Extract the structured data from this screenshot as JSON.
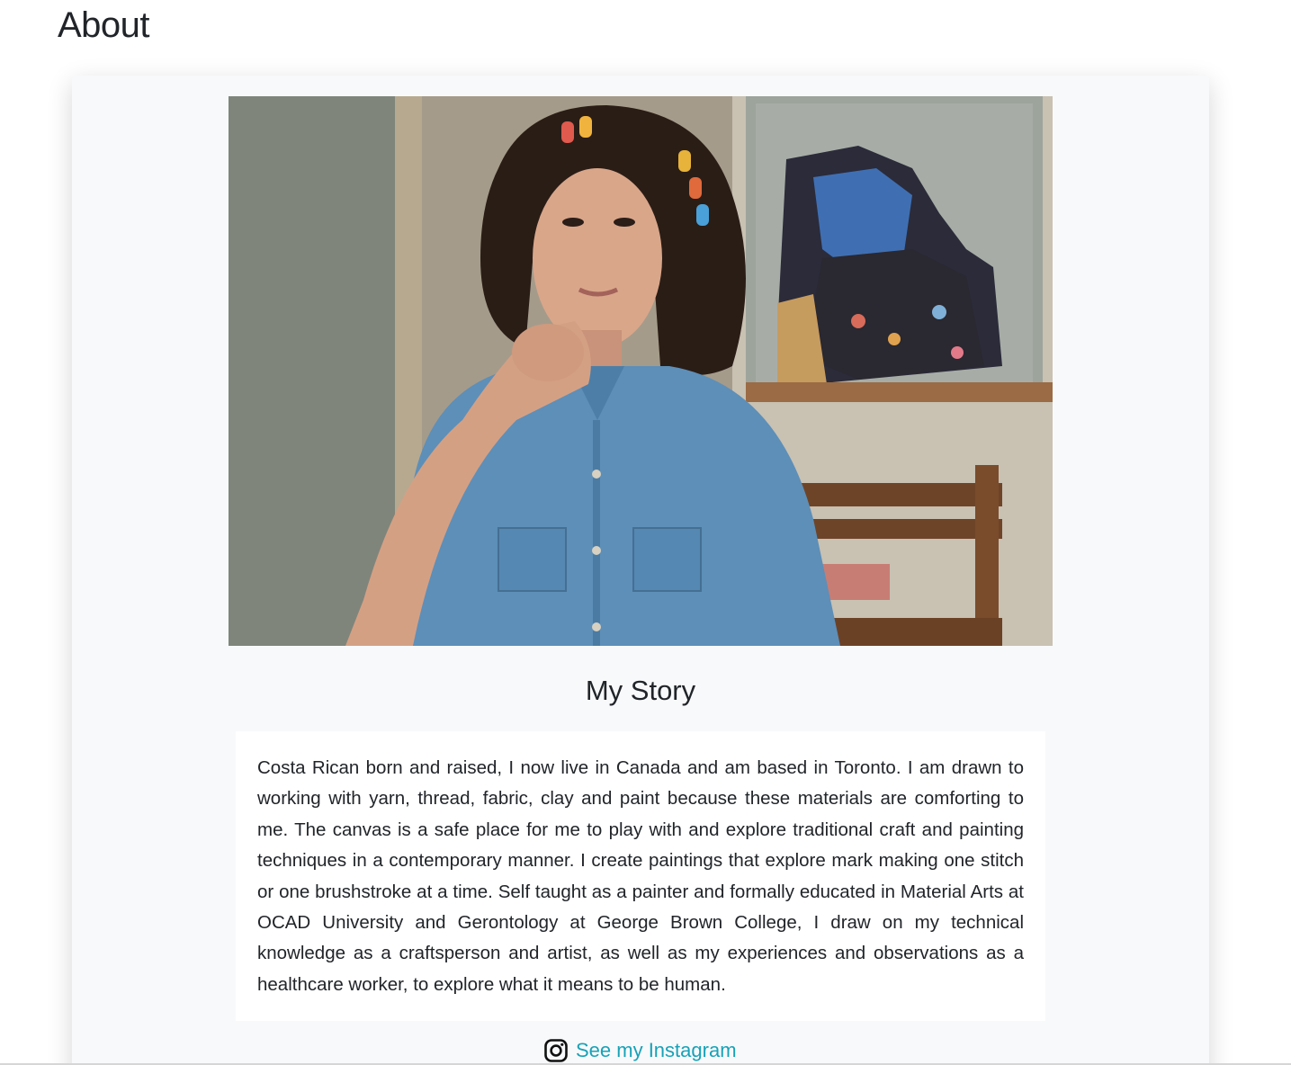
{
  "page": {
    "title": "About"
  },
  "profile_image": {
    "icon": "portrait-photo"
  },
  "story": {
    "heading": "My Story",
    "text": "Costa Rican born and raised, I now live in Canada and am based in Toronto. I am drawn to working with yarn, thread, fabric, clay and paint because these materials are comforting to me. The canvas is a safe place for me to play with and explore traditional craft and painting techniques in a contemporary manner. I create paintings that explore mark making one stitch or one brushstroke at a time. Self taught as a painter and formally educated in Material Arts at OCAD University and Gerontology at George Brown College, I draw on my technical knowledge as a craftsperson and artist, as well as my experiences and observations as a healthcare worker, to explore what it means to be human."
  },
  "instagram": {
    "label": "See my Instagram",
    "icon": "instagram-icon"
  },
  "colors": {
    "link": "#17a2b8",
    "card_background": "#f8f9fa",
    "text": "#212529"
  }
}
